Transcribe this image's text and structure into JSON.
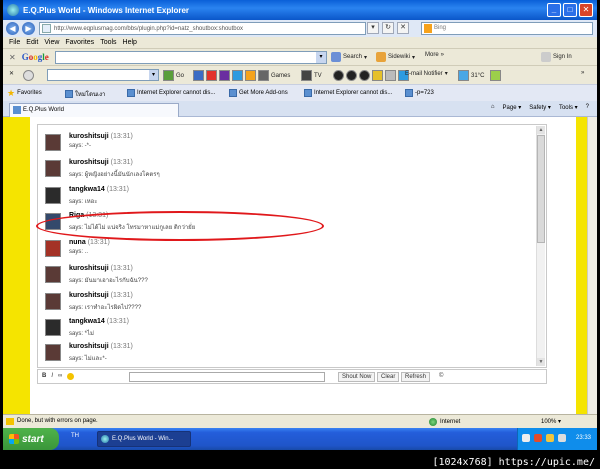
{
  "window": {
    "title": "E.Q.Plus World - Windows Internet Explorer",
    "min": "_",
    "max": "□",
    "close": "✕"
  },
  "address": {
    "url": "http://www.eqplusmag.com/bbs/plugin.php?id=natz_shoutbox:shoutbox",
    "bing_placeholder": "Bing"
  },
  "menu": [
    "File",
    "Edit",
    "View",
    "Favorites",
    "Tools",
    "Help"
  ],
  "google_toolbar": {
    "logo": [
      "G",
      "o",
      "o",
      "g",
      "l",
      "e"
    ],
    "search_label": "Search",
    "sidewiki_label": "Sidewiki",
    "more_label": "More",
    "signin_label": "Sign In"
  },
  "toolbar2": {
    "go_label": "Go",
    "games_label": "Games",
    "tv_label": "TV",
    "email_label": "E-mail Notifier",
    "weather_label": "31°C"
  },
  "favorites": {
    "label": "Favorites",
    "items": [
      "ใหม่โดนเงา",
      "Internet Explorer cannot dis...",
      "Get More Add-ons",
      "Internet Explorer cannot dis...",
      "-p=723"
    ]
  },
  "tabs": [
    {
      "label": "E.Q.Plus World"
    }
  ],
  "commands": [
    "Page",
    "Safety",
    "Tools",
    "?"
  ],
  "shoutbox": {
    "messages": [
      {
        "user": "kuroshitsuji",
        "time": "(13:31)",
        "says": "says: -*-",
        "color": "#5a3a36"
      },
      {
        "user": "kuroshitsuji",
        "time": "(13:31)",
        "says": "says: ผู้หญิงอย่างนี้มันนักเลงโคตรๆ",
        "color": "#5a3a36"
      },
      {
        "user": "tangkwa14",
        "time": "(13:31)",
        "says": "says: เหอะ",
        "color": "#2b2b2b"
      },
      {
        "user": "Riga",
        "time": "(13:31)",
        "says": "says: ไม่ได้ไม่ แน่จริง โทรมาหาแม่กูเลย ติกว่ายั่ย",
        "color": "#34496b"
      },
      {
        "user": "nuna",
        "time": "(13:31)",
        "says": "says: ..",
        "color": "#a43226"
      },
      {
        "user": "kuroshitsuji",
        "time": "(13:31)",
        "says": "says: มันมาเอาอะไรกับฉัน???",
        "color": "#5a3a36"
      },
      {
        "user": "kuroshitsuji",
        "time": "(13:31)",
        "says": "says: เราทำอะไรผิดไป????",
        "color": "#5a3a36"
      },
      {
        "user": "tangkwa14",
        "time": "(13:31)",
        "says": "says: *ไม่",
        "color": "#2b2b2b"
      },
      {
        "user": "kuroshitsuji",
        "time": "(13:31)",
        "says": "says: ไม่และ*-",
        "color": "#5a3a36"
      }
    ],
    "format_buttons": [
      "B",
      "I",
      "∞"
    ],
    "shout_now": "Shout Now",
    "clear": "Clear",
    "refresh": "Refresh",
    "copyright": "©"
  },
  "status": {
    "text": "Done, but with errors on page.",
    "zone": "Internet",
    "zoom": "100%"
  },
  "taskbar": {
    "start": "start",
    "lang": "TH",
    "task": "E.Q.Plus World - Win...",
    "clock": "23:33"
  },
  "watermark": "[1024x768] https://upic.me/"
}
